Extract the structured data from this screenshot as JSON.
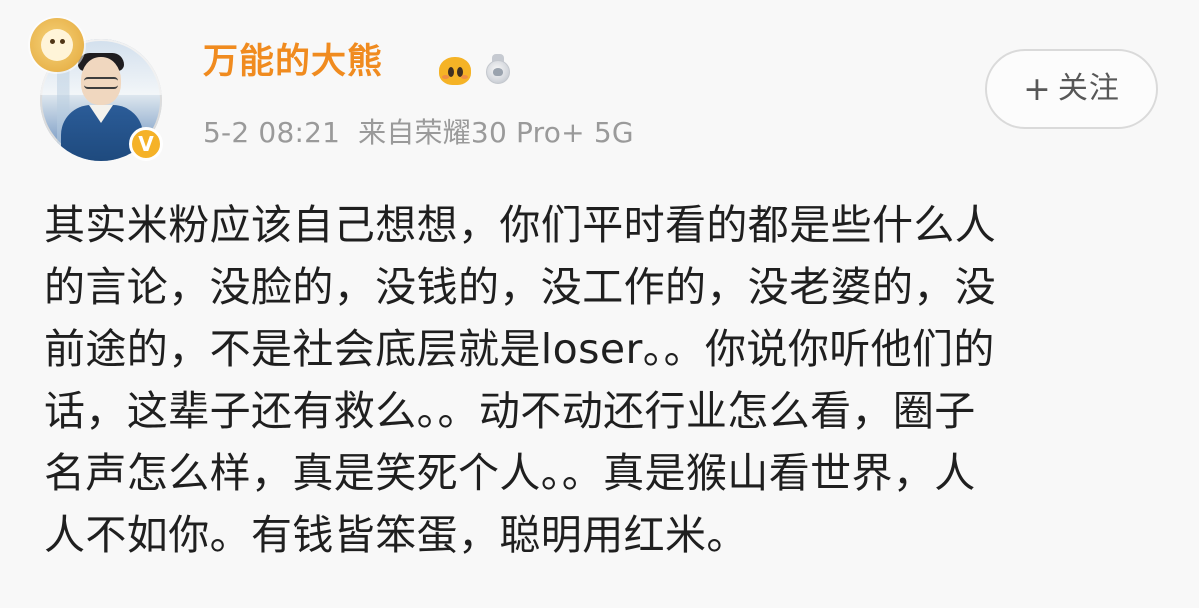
{
  "post": {
    "author": {
      "name": "万能的大熊",
      "verified_mark": "V",
      "icons": [
        "vip-bear-icon",
        "medal-icon"
      ]
    },
    "meta": {
      "time": "5-2 08:21",
      "source": "来自荣耀30 Pro+ 5G"
    },
    "follow_button": {
      "plus": "+",
      "label": "关注"
    },
    "content_lines": [
      "其实米粉应该自己想想，你们平时看的都是些什么人",
      "的言论，没脸的，没钱的，没工作的，没老婆的，没",
      "前途的，不是社会底层就是loser。。你说你听他们的",
      "话，这辈子还有救么。。动不动还行业怎么看，圈子",
      "名声怎么样，真是笑死个人。。真是猴山看世界，人",
      "人不如你。有钱皆笨蛋，聪明用红米。"
    ]
  },
  "colors": {
    "username": "#f08b1f",
    "meta": "#9a9a9a",
    "text": "#1f1f1f",
    "background": "#f8f8f8",
    "follow_border": "#dadada",
    "verified_badge": "#f5b228"
  }
}
